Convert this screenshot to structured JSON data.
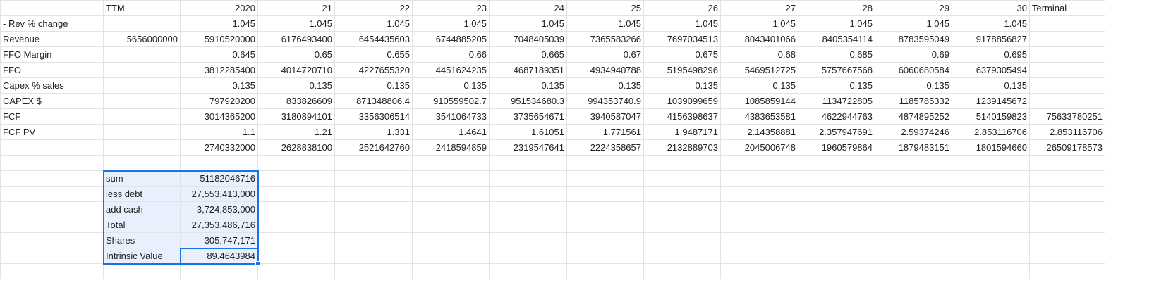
{
  "header": [
    "",
    "TTM",
    "2020",
    "21",
    "22",
    "23",
    "24",
    "25",
    "26",
    "27",
    "28",
    "29",
    "30",
    "Terminal"
  ],
  "rows": [
    [
      "- Rev % change",
      "",
      "1.045",
      "1.045",
      "1.045",
      "1.045",
      "1.045",
      "1.045",
      "1.045",
      "1.045",
      "1.045",
      "1.045",
      "1.045",
      ""
    ],
    [
      "Revenue",
      "5656000000",
      "5910520000",
      "6176493400",
      "6454435603",
      "6744885205",
      "7048405039",
      "7365583266",
      "7697034513",
      "8043401066",
      "8405354114",
      "8783595049",
      "9178856827",
      ""
    ],
    [
      "FFO Margin",
      "",
      "0.645",
      "0.65",
      "0.655",
      "0.66",
      "0.665",
      "0.67",
      "0.675",
      "0.68",
      "0.685",
      "0.69",
      "0.695",
      ""
    ],
    [
      "FFO",
      "",
      "3812285400",
      "4014720710",
      "4227655320",
      "4451624235",
      "4687189351",
      "4934940788",
      "5195498296",
      "5469512725",
      "5757667568",
      "6060680584",
      "6379305494",
      ""
    ],
    [
      "Capex % sales",
      "",
      "0.135",
      "0.135",
      "0.135",
      "0.135",
      "0.135",
      "0.135",
      "0.135",
      "0.135",
      "0.135",
      "0.135",
      "0.135",
      ""
    ],
    [
      "CAPEX $",
      "",
      "797920200",
      "833826609",
      "871348806.4",
      "910559502.7",
      "951534680.3",
      "994353740.9",
      "1039099659",
      "1085859144",
      "1134722805",
      "1185785332",
      "1239145672",
      ""
    ],
    [
      "FCF",
      "",
      "3014365200",
      "3180894101",
      "3356306514",
      "3541064733",
      "3735654671",
      "3940587047",
      "4156398637",
      "4383653581",
      "4622944763",
      "4874895252",
      "5140159823",
      "75633780251"
    ],
    [
      "FCF PV",
      "",
      "1.1",
      "1.21",
      "1.331",
      "1.4641",
      "1.61051",
      "1.771561",
      "1.9487171",
      "2.14358881",
      "2.357947691",
      "2.59374246",
      "2.853116706",
      "2.853116706"
    ],
    [
      "",
      "",
      "2740332000",
      "2628838100",
      "2521642760",
      "2418594859",
      "2319547641",
      "2224358657",
      "2132889703",
      "2045006748",
      "1960579864",
      "1879483151",
      "1801594660",
      "26509178573"
    ],
    [
      "",
      "",
      "",
      "",
      "",
      "",
      "",
      "",
      "",
      "",
      "",
      "",
      "",
      ""
    ],
    [
      "",
      "sum",
      "51182046716",
      "",
      "",
      "",
      "",
      "",
      "",
      "",
      "",
      "",
      "",
      ""
    ],
    [
      "",
      "less debt",
      "27,553,413,000",
      "",
      "",
      "",
      "",
      "",
      "",
      "",
      "",
      "",
      "",
      ""
    ],
    [
      "",
      "add cash",
      "3,724,853,000",
      "",
      "",
      "",
      "",
      "",
      "",
      "",
      "",
      "",
      "",
      ""
    ],
    [
      "",
      "Total",
      "27,353,486,716",
      "",
      "",
      "",
      "",
      "",
      "",
      "",
      "",
      "",
      "",
      ""
    ],
    [
      "",
      "Shares",
      "305,747,171",
      "",
      "",
      "",
      "",
      "",
      "",
      "",
      "",
      "",
      "",
      ""
    ],
    [
      "",
      "Intrinsic Value",
      "89.4643984",
      "",
      "",
      "",
      "",
      "",
      "",
      "",
      "",
      "",
      "",
      ""
    ],
    [
      "",
      "",
      "",
      "",
      "",
      "",
      "",
      "",
      "",
      "",
      "",
      "",
      "",
      ""
    ]
  ],
  "colors": {
    "selection_border": "#1a73e8",
    "selection_fill": "#e8f0fe",
    "gridline": "#e2e3e3"
  }
}
